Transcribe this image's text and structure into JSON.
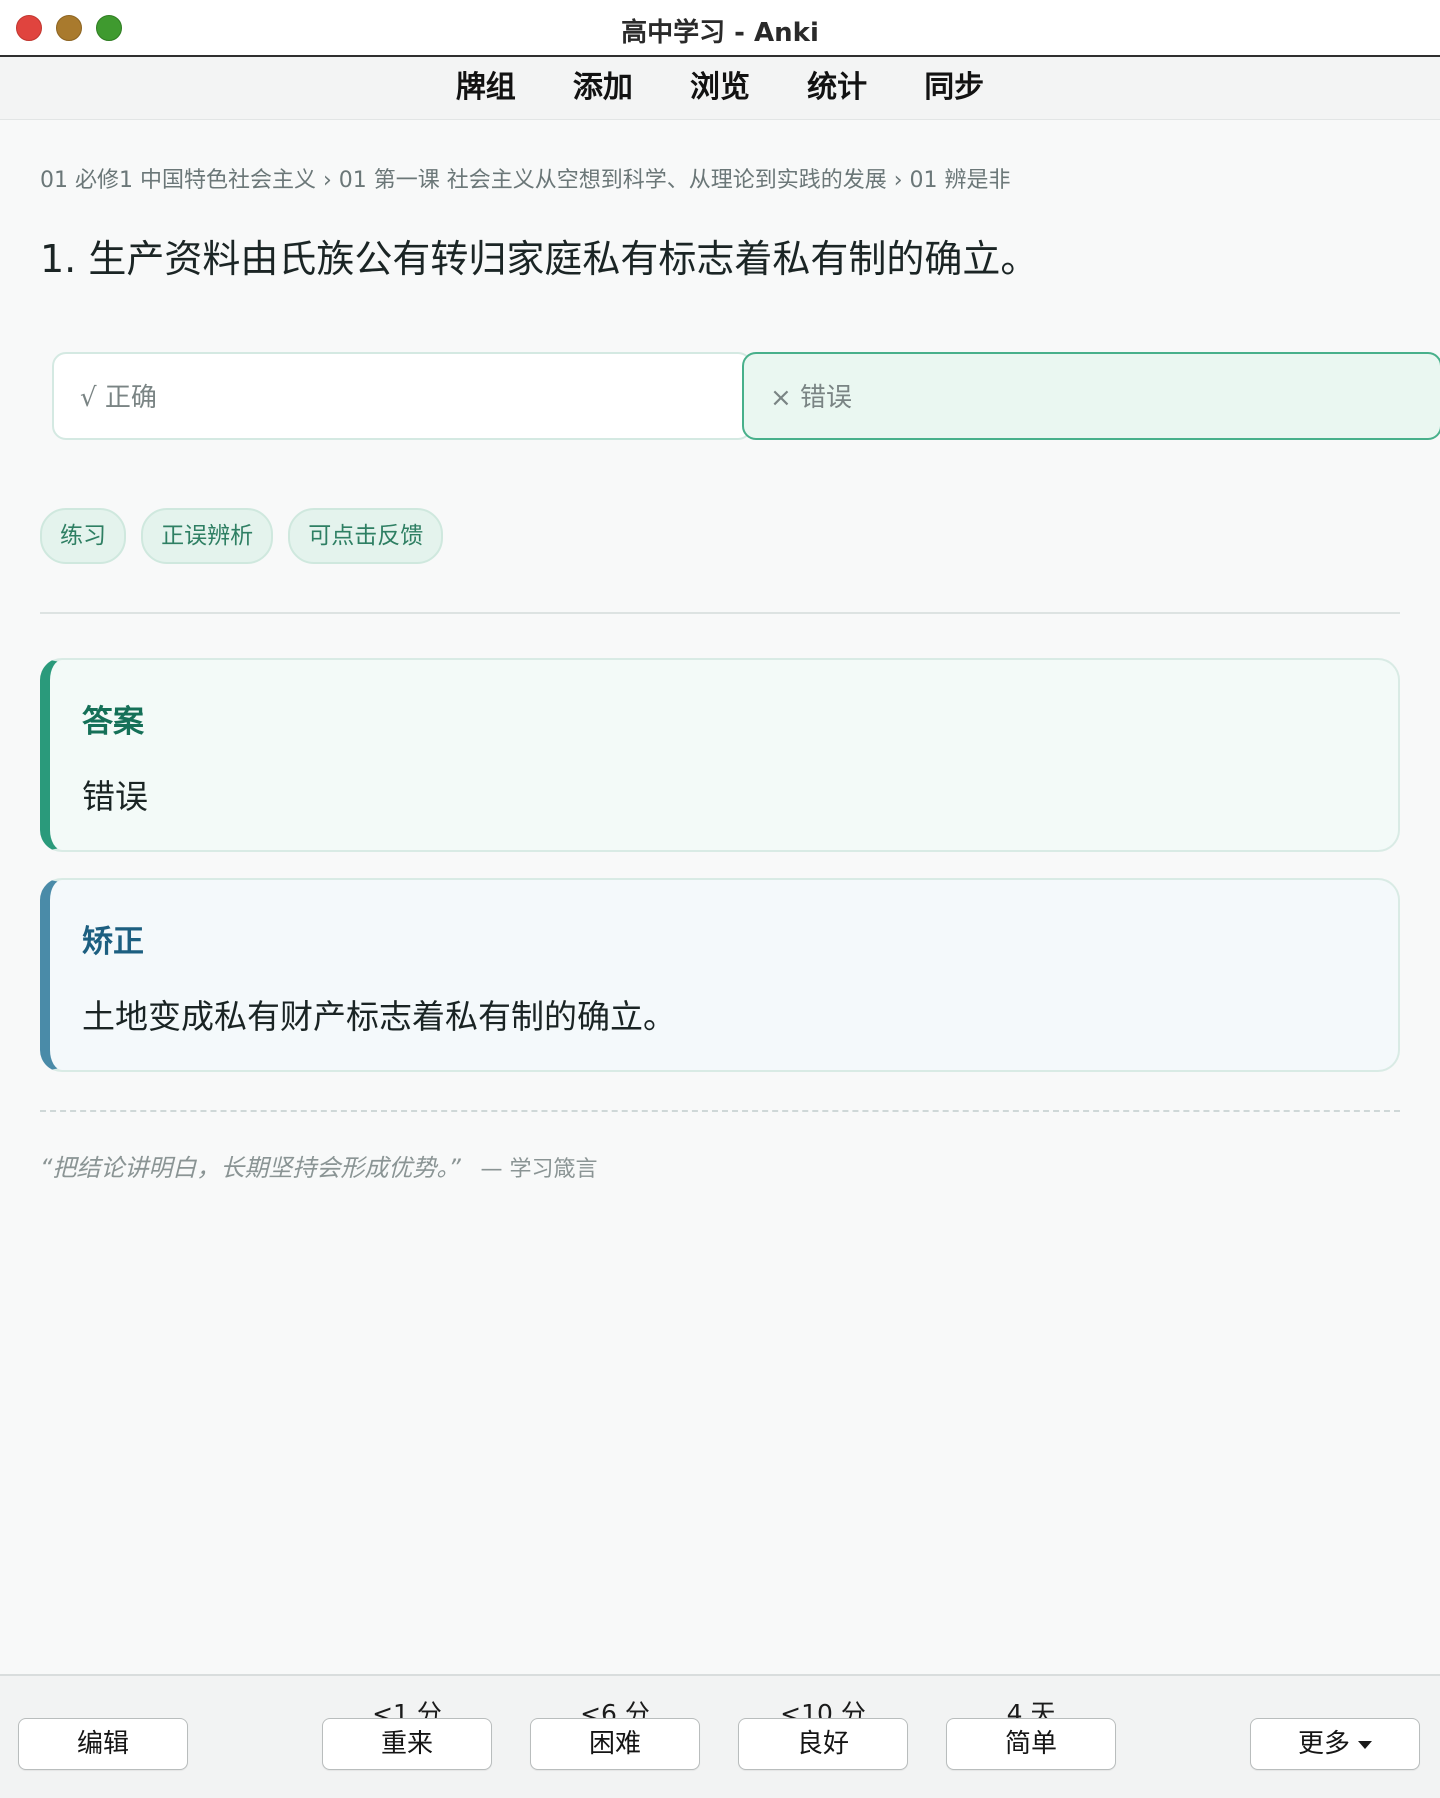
{
  "window": {
    "title": "高中学习 - Anki"
  },
  "topnav": {
    "items": [
      "牌组",
      "添加",
      "浏览",
      "统计",
      "同步"
    ]
  },
  "card": {
    "breadcrumb": "01 必修1 中国特色社会主义 › 01 第一课 社会主义从空想到科学、从理论到实践的发展 › 01 辨是非",
    "question": "1.  生产资料由氏族公有转归家庭私有标志着私有制的确立。",
    "choices": {
      "correct": "√ 正确",
      "wrong": "× 错误"
    },
    "tags": [
      "练习",
      "正误辨析",
      "可点击反馈"
    ],
    "answer": {
      "title": "答案",
      "body": "错误"
    },
    "correction": {
      "title": "矫正",
      "body": "土地变成私有财产标志着私有制的确立。"
    },
    "motto": {
      "quote": "“把结论讲明白，长期坚持会形成优势。”",
      "source": "— 学习箴言"
    }
  },
  "bottombar": {
    "edit_label": "编辑",
    "more_label": "更多",
    "answers": [
      {
        "interval": "<1 分",
        "label": "重来"
      },
      {
        "interval": "<6 分",
        "label": "困难"
      },
      {
        "interval": "<10 分",
        "label": "良好"
      },
      {
        "interval": "4 天",
        "label": "简单"
      }
    ]
  },
  "colors": {
    "accent_green": "#2a9a7b",
    "accent_blue": "#4a8ba8",
    "selected_choice_border": "#48b08b"
  }
}
